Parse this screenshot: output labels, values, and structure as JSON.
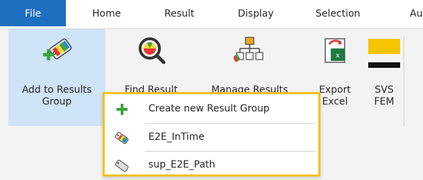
{
  "tabs": [
    "File",
    "Home",
    "Result",
    "Display",
    "Selection",
    "Au"
  ],
  "ribbon": {
    "buttons": [
      {
        "lines": [
          "Add to Results",
          "Group"
        ],
        "icon": "add-tag-icon"
      },
      {
        "lines": [
          "Find Result",
          ""
        ],
        "icon": "magnifier-icon"
      },
      {
        "lines": [
          "Manage Results",
          ""
        ],
        "icon": "hierarchy-icon"
      },
      {
        "lines": [
          "Export",
          "Excel"
        ],
        "icon": "excel-icon"
      },
      {
        "lines": [
          "SVS",
          "FEM"
        ],
        "icon": "svs-icon"
      }
    ]
  },
  "menu": {
    "items": [
      {
        "label": "Create new Result Group",
        "icon": "plus-icon"
      },
      {
        "label": "E2E_InTime",
        "icon": "colored-tag-icon"
      },
      {
        "label": "sup_E2E_Path",
        "icon": "gray-tag-icon"
      }
    ]
  },
  "colors": {
    "file_tab": "#1e6fbf",
    "selection": "#cfe4f7",
    "menu_border": "#f5c211",
    "plus_green": "#3aa53a",
    "excel_green": "#1d7a45",
    "svs_yellow": "#f5c400"
  }
}
